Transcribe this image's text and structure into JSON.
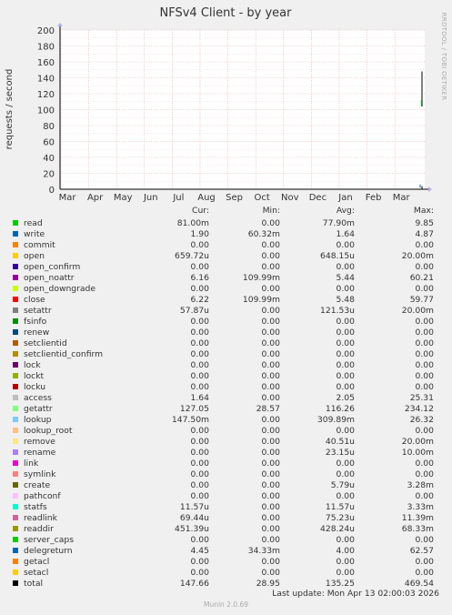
{
  "chart_data": {
    "type": "line",
    "title": "NFSv4 Client - by year",
    "ylabel": "requests / second",
    "xlabel": "",
    "ylim": [
      0,
      200
    ],
    "yticks": [
      0,
      20,
      40,
      60,
      80,
      100,
      120,
      140,
      160,
      180,
      200
    ],
    "x_tick_labels": [
      "Mar",
      "Apr",
      "May",
      "Jun",
      "Jul",
      "Aug",
      "Sep",
      "Oct",
      "Nov",
      "Dec",
      "Jan",
      "Feb",
      "Mar"
    ],
    "side_text": "RRDTOOL / TOBI OETIKER",
    "grid": true,
    "spike": {
      "x_position": "end of range (Apr 2026)",
      "low": 104,
      "high": 148
    }
  },
  "legend": {
    "headers": [
      "Cur:",
      "Min:",
      "Avg:",
      "Max:"
    ],
    "rows": [
      {
        "name": "read",
        "color": "#00cc00",
        "cur": "81.00m",
        "min": "0.00",
        "avg": "77.90m",
        "max": "9.85"
      },
      {
        "name": "write",
        "color": "#0066b3",
        "cur": "1.90",
        "min": "60.32m",
        "avg": "1.64",
        "max": "4.87"
      },
      {
        "name": "commit",
        "color": "#ff8000",
        "cur": "0.00",
        "min": "0.00",
        "avg": "0.00",
        "max": "0.00"
      },
      {
        "name": "open",
        "color": "#ffcc00",
        "cur": "659.72u",
        "min": "0.00",
        "avg": "648.15u",
        "max": "20.00m"
      },
      {
        "name": "open_confirm",
        "color": "#330099",
        "cur": "0.00",
        "min": "0.00",
        "avg": "0.00",
        "max": "0.00"
      },
      {
        "name": "open_noattr",
        "color": "#990099",
        "cur": "6.16",
        "min": "109.99m",
        "avg": "5.44",
        "max": "60.21"
      },
      {
        "name": "open_downgrade",
        "color": "#ccff00",
        "cur": "0.00",
        "min": "0.00",
        "avg": "0.00",
        "max": "0.00"
      },
      {
        "name": "close",
        "color": "#ff0000",
        "cur": "6.22",
        "min": "109.99m",
        "avg": "5.48",
        "max": "59.77"
      },
      {
        "name": "setattr",
        "color": "#808080",
        "cur": "57.87u",
        "min": "0.00",
        "avg": "121.53u",
        "max": "20.00m"
      },
      {
        "name": "fsinfo",
        "color": "#008f00",
        "cur": "0.00",
        "min": "0.00",
        "avg": "0.00",
        "max": "0.00"
      },
      {
        "name": "renew",
        "color": "#00487d",
        "cur": "0.00",
        "min": "0.00",
        "avg": "0.00",
        "max": "0.00"
      },
      {
        "name": "setclientid",
        "color": "#b35a00",
        "cur": "0.00",
        "min": "0.00",
        "avg": "0.00",
        "max": "0.00"
      },
      {
        "name": "setclientid_confirm",
        "color": "#b38f00",
        "cur": "0.00",
        "min": "0.00",
        "avg": "0.00",
        "max": "0.00"
      },
      {
        "name": "lock",
        "color": "#6b006b",
        "cur": "0.00",
        "min": "0.00",
        "avg": "0.00",
        "max": "0.00"
      },
      {
        "name": "lockt",
        "color": "#8fb300",
        "cur": "0.00",
        "min": "0.00",
        "avg": "0.00",
        "max": "0.00"
      },
      {
        "name": "locku",
        "color": "#b30000",
        "cur": "0.00",
        "min": "0.00",
        "avg": "0.00",
        "max": "0.00"
      },
      {
        "name": "access",
        "color": "#bebebe",
        "cur": "1.64",
        "min": "0.00",
        "avg": "2.05",
        "max": "25.31"
      },
      {
        "name": "getattr",
        "color": "#80ff80",
        "cur": "127.05",
        "min": "28.57",
        "avg": "116.26",
        "max": "234.12"
      },
      {
        "name": "lookup",
        "color": "#80c9ff",
        "cur": "147.50m",
        "min": "0.00",
        "avg": "309.89m",
        "max": "26.32"
      },
      {
        "name": "lookup_root",
        "color": "#ffc080",
        "cur": "0.00",
        "min": "0.00",
        "avg": "0.00",
        "max": "0.00"
      },
      {
        "name": "remove",
        "color": "#ffe680",
        "cur": "0.00",
        "min": "0.00",
        "avg": "40.51u",
        "max": "20.00m"
      },
      {
        "name": "rename",
        "color": "#aa80ff",
        "cur": "0.00",
        "min": "0.00",
        "avg": "23.15u",
        "max": "10.00m"
      },
      {
        "name": "link",
        "color": "#ee00cc",
        "cur": "0.00",
        "min": "0.00",
        "avg": "0.00",
        "max": "0.00"
      },
      {
        "name": "symlink",
        "color": "#ff8080",
        "cur": "0.00",
        "min": "0.00",
        "avg": "0.00",
        "max": "0.00"
      },
      {
        "name": "create",
        "color": "#666600",
        "cur": "0.00",
        "min": "0.00",
        "avg": "5.79u",
        "max": "3.28m"
      },
      {
        "name": "pathconf",
        "color": "#ffbfff",
        "cur": "0.00",
        "min": "0.00",
        "avg": "0.00",
        "max": "0.00"
      },
      {
        "name": "statfs",
        "color": "#00ffcc",
        "cur": "11.57u",
        "min": "0.00",
        "avg": "11.57u",
        "max": "3.33m"
      },
      {
        "name": "readlink",
        "color": "#cc6699",
        "cur": "69.44u",
        "min": "0.00",
        "avg": "75.23u",
        "max": "11.39m"
      },
      {
        "name": "readdir",
        "color": "#999900",
        "cur": "451.39u",
        "min": "0.00",
        "avg": "428.24u",
        "max": "68.33m"
      },
      {
        "name": "server_caps",
        "color": "#00cc00",
        "cur": "0.00",
        "min": "0.00",
        "avg": "0.00",
        "max": "0.00"
      },
      {
        "name": "delegreturn",
        "color": "#0066b3",
        "cur": "4.45",
        "min": "34.33m",
        "avg": "4.00",
        "max": "62.57"
      },
      {
        "name": "getacl",
        "color": "#ff8000",
        "cur": "0.00",
        "min": "0.00",
        "avg": "0.00",
        "max": "0.00"
      },
      {
        "name": "setacl",
        "color": "#ffcc00",
        "cur": "0.00",
        "min": "0.00",
        "avg": "0.00",
        "max": "0.00"
      },
      {
        "name": "total",
        "color": "#000000",
        "cur": "147.66",
        "min": "28.95",
        "avg": "135.25",
        "max": "469.54"
      }
    ]
  },
  "last_update": "Last update: Mon Apr 13 02:00:03 2026",
  "footer": "Munin 2.0.69"
}
